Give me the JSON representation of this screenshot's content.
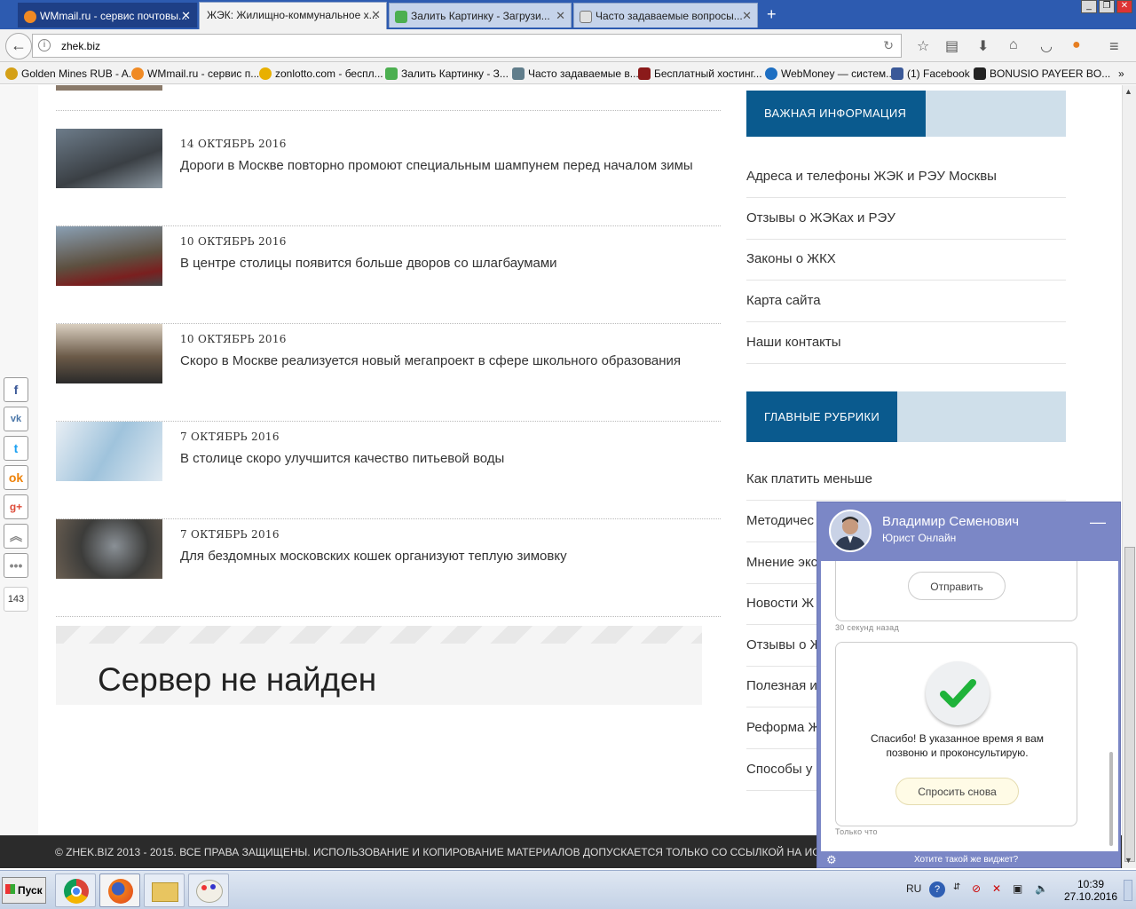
{
  "browser": {
    "tabs": [
      {
        "label": "WMmail.ru - сервис почтовы...",
        "icon": "at-icon",
        "active": false
      },
      {
        "label": "ЖЭК: Жилищно-коммунальное х...",
        "icon": "zhek-icon",
        "active": true
      },
      {
        "label": "Залить Картинку - Загрузи...",
        "icon": "image-upload-icon",
        "active": false
      },
      {
        "label": "Часто задаваемые вопросы...",
        "icon": "doc-icon",
        "active": false
      }
    ],
    "new_tab": "+",
    "url": "zhek.biz",
    "bookmarks": [
      {
        "label": "Golden Mines RUB - A...",
        "color": "#d4a017"
      },
      {
        "label": "WMmail.ru - сервис п...",
        "color": "#f08a24"
      },
      {
        "label": "zonlotto.com - беспл...",
        "color": "#e8b000"
      },
      {
        "label": "Залить Картинку - З...",
        "color": "#4caf50"
      },
      {
        "label": "Часто задаваемые в...",
        "color": "#607d8b"
      },
      {
        "label": "Бесплатный хостинг...",
        "color": "#8b1a1a"
      },
      {
        "label": "WebMoney — систем...",
        "color": "#1e6fc2"
      },
      {
        "label": "(1) Facebook",
        "color": "#3b5998"
      },
      {
        "label": "BONUSIO PAYEER BO...",
        "color": "#222222"
      }
    ]
  },
  "news": [
    {
      "date": "14 ОКТЯБРЬ 2016",
      "title": "Дороги в Москве повторно промоют специальным шампунем перед началом зимы"
    },
    {
      "date": "10 ОКТЯБРЬ 2016",
      "title": "В центре столицы появится больше дворов со шлагбаумами"
    },
    {
      "date": "10 ОКТЯБРЬ 2016",
      "title": "Скоро в Москве реализуется новый мегапроект в сфере школьного образования"
    },
    {
      "date": "7 ОКТЯБРЬ 2016",
      "title": "В столице скоро улучшится качество питьевой воды"
    },
    {
      "date": "7 ОКТЯБРЬ 2016",
      "title": "Для бездомных московских кошек организуют теплую зимовку"
    }
  ],
  "error_text": "Сервер не найден",
  "sidebar": {
    "important_title": "ВАЖНАЯ ИНФОРМАЦИЯ",
    "important_links": [
      "Адреса и телефоны ЖЭК и РЭУ Москвы",
      "Отзывы о ЖЭКах и РЭУ",
      "Законы о ЖКХ",
      "Карта сайта",
      "Наши контакты"
    ],
    "rubrics_title": "ГЛАВНЫЕ РУБРИКИ",
    "rubrics_links": [
      "Как платить меньше",
      "Методичес",
      "Мнение экс",
      "Новости Ж",
      "Отзывы о Ж",
      "Полезная и",
      "Реформа Ж",
      "Способы у"
    ]
  },
  "share_count": "143",
  "footer": "© ZHEK.BIZ 2013 - 2015. ВСЕ ПРАВА ЗАЩИЩЕНЫ. ИСПОЛЬЗОВАНИЕ И КОПИРОВАНИЕ МАТЕРИАЛОВ ДОПУСКАЕТСЯ ТОЛЬКО СО ССЫЛКОЙ НА ИСТ",
  "chat": {
    "name": "Владимир Семенович",
    "role": "Юрист Онлайн",
    "send_label": "Отправить",
    "time1": "30 секунд назад",
    "thanks": "Спасибо! В указанное время я вам позвоню и проконсультирую.",
    "ask_again": "Спросить снова",
    "time2": "Только что",
    "widget_link": "Хотите такой же виджет?"
  },
  "taskbar": {
    "start": "Пуск",
    "lang": "RU",
    "time": "10:39",
    "date": "27.10.2016"
  }
}
